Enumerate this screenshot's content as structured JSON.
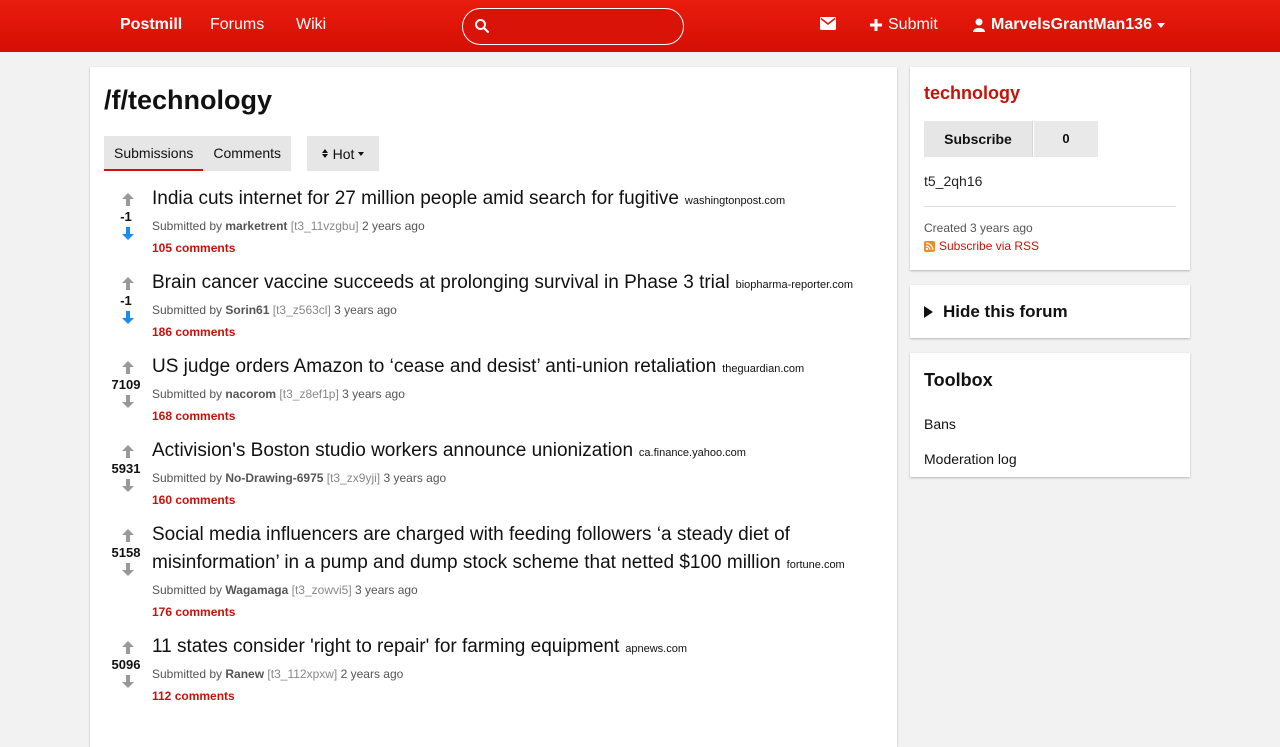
{
  "navbar": {
    "brand": "Postmill",
    "links": [
      "Forums",
      "Wiki"
    ],
    "search": {
      "placeholder": "",
      "value": ""
    },
    "submit_label": "Submit",
    "username": "MarvelsGrantMan136",
    "bg_color": "#e4160a"
  },
  "main": {
    "title": "/f/technology",
    "tabs": [
      {
        "label": "Submissions",
        "active": true
      },
      {
        "label": "Comments",
        "active": false
      }
    ],
    "sort_label": "Hot",
    "submissions": [
      {
        "title": "India cuts internet for 27 million people amid search for fugitive",
        "domain": "washingtonpost.com",
        "submitted_by": "Submitted by",
        "author": "marketrent",
        "id": "[t3_11vzgbu]",
        "age": "2 years ago",
        "comments": "105 comments",
        "score": "-1",
        "vote_state": "down"
      },
      {
        "title": "Brain cancer vaccine succeeds at prolonging survival in Phase 3 trial",
        "domain": "biopharma-reporter.com",
        "submitted_by": "Submitted by",
        "author": "Sorin61",
        "id": "[t3_z563cl]",
        "age": "3 years ago",
        "comments": "186 comments",
        "score": "-1",
        "vote_state": "down"
      },
      {
        "title": "US judge orders Amazon to ‘cease and desist’ anti-union retaliation",
        "domain": "theguardian.com",
        "submitted_by": "Submitted by",
        "author": "nacorom",
        "id": "[t3_z8ef1p]",
        "age": "3 years ago",
        "comments": "168 comments",
        "score": "7109",
        "vote_state": "none"
      },
      {
        "title": "Activision's Boston studio workers announce unionization",
        "domain": "ca.finance.yahoo.com",
        "submitted_by": "Submitted by",
        "author": "No-Drawing-6975",
        "id": "[t3_zx9yji]",
        "age": "3 years ago",
        "comments": "160 comments",
        "score": "5931",
        "vote_state": "none"
      },
      {
        "title": "Social media influencers are charged with feeding followers ‘a steady diet of misinformation’ in a pump and dump stock scheme that netted $100 million",
        "domain": "fortune.com",
        "submitted_by": "Submitted by",
        "author": "Wagamaga",
        "id": "[t3_zowvi5]",
        "age": "3 years ago",
        "comments": "176 comments",
        "score": "5158",
        "vote_state": "none"
      },
      {
        "title": "11 states consider 'right to repair' for farming equipment",
        "domain": "apnews.com",
        "submitted_by": "Submitted by",
        "author": "Ranew",
        "id": "[t3_112xpxw]",
        "age": "2 years ago",
        "comments": "112 comments",
        "score": "5096",
        "vote_state": "none"
      }
    ]
  },
  "sidebar": {
    "forum_name": "technology",
    "subscribe_label": "Subscribe",
    "subscriber_count": "0",
    "forum_id": "t5_2qh16",
    "created": "Created 3 years ago",
    "rss_label": "Subscribe via RSS",
    "hide_label": "Hide this forum",
    "toolbox_title": "Toolbox",
    "toolbox_items": [
      "Bans",
      "Moderation log"
    ],
    "accent_color": "#c6130a"
  }
}
